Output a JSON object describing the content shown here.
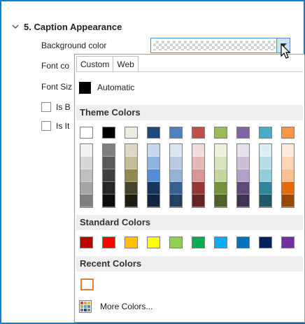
{
  "section": {
    "title": "5. Caption Appearance"
  },
  "properties": {
    "background_color_label": "Background color",
    "font_color_label": "Font co",
    "font_size_label": "Font Siz",
    "is_bold_label": "Is B",
    "is_italic_label": "Is It"
  },
  "popup": {
    "tabs": [
      "Custom",
      "Web"
    ],
    "automatic_label": "Automatic",
    "theme_colors_label": "Theme Colors",
    "standard_colors_label": "Standard Colors",
    "recent_colors_label": "Recent Colors",
    "more_colors_label": "More Colors...",
    "theme_top": [
      "#FFFFFF",
      "#000000",
      "#EEECE1",
      "#1F497D",
      "#4F81BD",
      "#C0504D",
      "#9BBB59",
      "#8064A2",
      "#4BACC6",
      "#F79646"
    ],
    "theme_shades": [
      [
        "#F2F2F2",
        "#D8D8D8",
        "#BFBFBF",
        "#A5A5A5",
        "#7F7F7F"
      ],
      [
        "#7F7F7F",
        "#595959",
        "#3F3F3F",
        "#262626",
        "#0C0C0C"
      ],
      [
        "#DDD9C3",
        "#C4BD97",
        "#938953",
        "#494429",
        "#1D1B10"
      ],
      [
        "#C6D9F0",
        "#8DB3E2",
        "#548DD4",
        "#17365D",
        "#0F243E"
      ],
      [
        "#DBE5F1",
        "#B8CCE4",
        "#95B3D7",
        "#366092",
        "#244061"
      ],
      [
        "#F2DCDB",
        "#E5B9B7",
        "#D99694",
        "#953734",
        "#632423"
      ],
      [
        "#EBF1DD",
        "#D7E3BC",
        "#C3D69B",
        "#76923C",
        "#4F6128"
      ],
      [
        "#E5E0EC",
        "#CCC1D9",
        "#B2A2C7",
        "#5F497A",
        "#3F3151"
      ],
      [
        "#DBEEF3",
        "#B7DDE8",
        "#92CDDC",
        "#31859B",
        "#205867"
      ],
      [
        "#FDEADA",
        "#FBD5B5",
        "#FAC08F",
        "#E36C09",
        "#974806"
      ]
    ],
    "standard": [
      "#C00000",
      "#FF0000",
      "#FFC000",
      "#FFFF00",
      "#92D050",
      "#00B050",
      "#00B0F0",
      "#0070C0",
      "#002060",
      "#7030A0"
    ],
    "recent": [
      "#FFFFFF"
    ]
  }
}
